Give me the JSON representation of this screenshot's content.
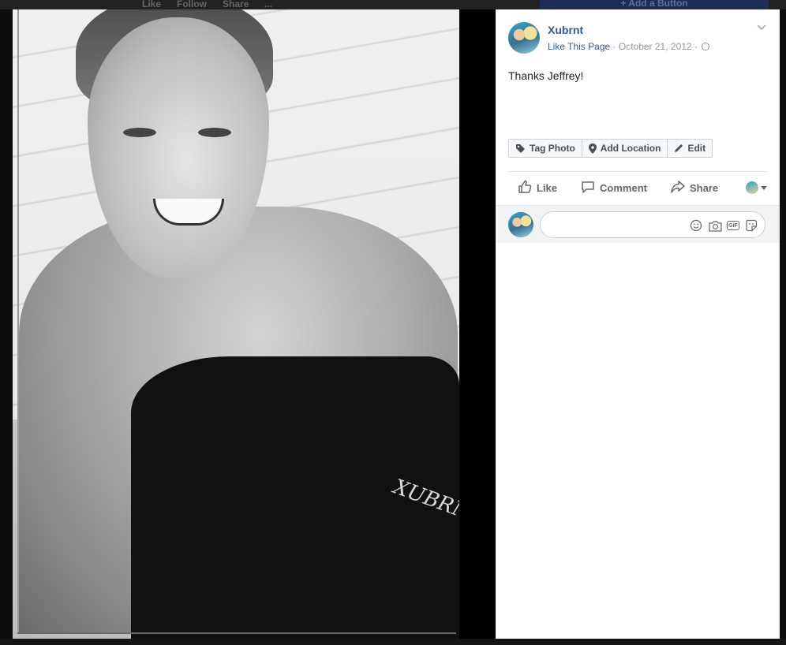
{
  "background": {
    "actions": [
      "Like",
      "Follow",
      "Share",
      "..."
    ],
    "button_label": "+ Add a Button"
  },
  "photo": {
    "logo_text": "XUBRNT",
    "colors": {
      "stage": "#000000",
      "shorts": "#111111"
    }
  },
  "post": {
    "page_name": "Xubrnt",
    "like_link": "Like This Page",
    "separator": "·",
    "date": "October 21, 2012",
    "privacy_icon": "globe-icon",
    "caption": "Thanks Jeffrey!"
  },
  "photo_tools": {
    "tag_photo": "Tag Photo",
    "add_location": "Add Location",
    "edit": "Edit"
  },
  "actions": {
    "like": "Like",
    "comment": "Comment",
    "share": "Share"
  },
  "comment_box": {
    "placeholder": "",
    "icons": [
      "emoji-icon",
      "camera-icon",
      "gif-icon",
      "sticker-icon"
    ],
    "gif_label": "GIF"
  },
  "colors": {
    "link": "#365899",
    "meta": "#90949c",
    "text": "#1d2129",
    "action": "#606770"
  }
}
